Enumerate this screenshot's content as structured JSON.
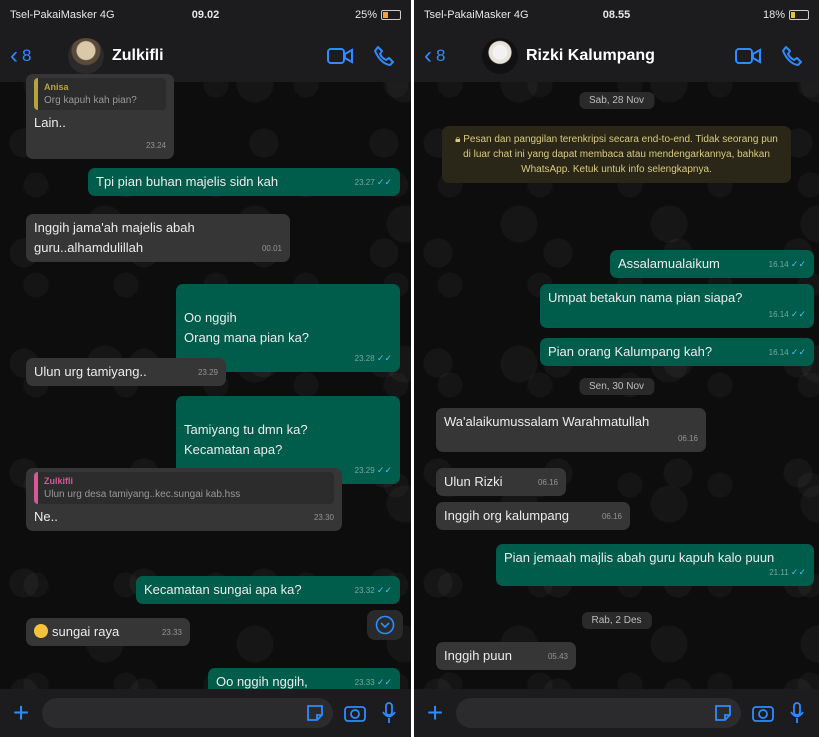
{
  "left": {
    "status": {
      "carrier": "Tsel-PakaiMasker 4G",
      "time": "09.02",
      "battery": "25%"
    },
    "header": {
      "back_count": "8",
      "name": "Zulkifli"
    },
    "top_quote": {
      "author": "Anisa",
      "text": "Org kapuh kah pian?"
    },
    "messages": [
      {
        "text": "Lain..",
        "time": "23.24"
      },
      {
        "text": "Tpi pian buhan majelis sidn kah",
        "time": "23.27"
      },
      {
        "text": "Inggih jama'ah majelis abah guru..alhamdulillah",
        "time": "00.01"
      },
      {
        "text": "Oo nggih\nOrang mana pian ka?",
        "time": "23.28"
      },
      {
        "text": "Ulun urg tamiyang..",
        "time": "23.29"
      },
      {
        "text": "Tamiyang tu dmn ka?\nKecamatan apa?",
        "time": "23.29"
      },
      {
        "quote_author": "Zulkifli",
        "quote_text": "Ulun urg desa tamiyang..kec.sungai kab.hss",
        "text": "Ne..",
        "time": "23.30"
      },
      {
        "text": "Kecamatan sungai apa ka?",
        "time": "23.32"
      },
      {
        "text": "sungai raya",
        "time": "23.33"
      },
      {
        "text": "Oo nggih nggih,",
        "time": "23.33"
      }
    ]
  },
  "right": {
    "status": {
      "carrier": "Tsel-PakaiMasker 4G",
      "time": "08.55",
      "battery": "18%"
    },
    "header": {
      "back_count": "8",
      "name": "Rizki Kalumpang"
    },
    "date1": "Sab, 28 Nov",
    "encryption": "Pesan dan panggilan terenkripsi secara end-to-end. Tidak seorang pun di luar chat ini yang dapat membaca atau mendengarkannya, bahkan WhatsApp. Ketuk untuk info selengkapnya.",
    "messages1": [
      {
        "text": "Assalamualaikum",
        "time": "16.14"
      },
      {
        "text": "Umpat betakun nama pian siapa?",
        "time": "16.14"
      },
      {
        "text": "Pian orang Kalumpang kah?",
        "time": "16.14"
      }
    ],
    "date2": "Sen, 30 Nov",
    "messages2": [
      {
        "text": "Wa'alaikumussalam Warahmatullah",
        "time": "06.16"
      },
      {
        "text": "Ulun Rizki",
        "time": "06.16"
      },
      {
        "text": "Inggih org kalumpang",
        "time": "06.16"
      },
      {
        "text": "Pian jemaah majlis abah guru kapuh kalo puun",
        "time": "21.11"
      }
    ],
    "date3": "Rab, 2 Des",
    "messages3": [
      {
        "text": "Inggih puun",
        "time": "05.43"
      }
    ]
  }
}
